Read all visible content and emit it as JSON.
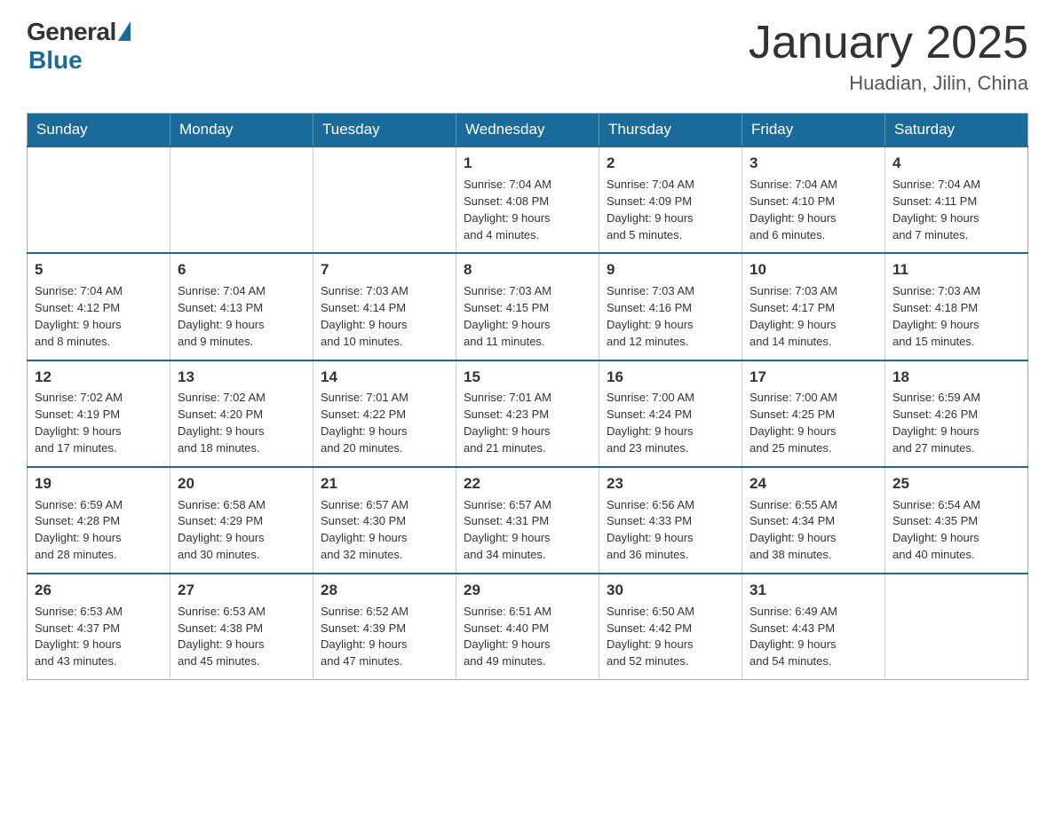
{
  "logo": {
    "general": "General",
    "blue": "Blue"
  },
  "title": "January 2025",
  "subtitle": "Huadian, Jilin, China",
  "headers": [
    "Sunday",
    "Monday",
    "Tuesday",
    "Wednesday",
    "Thursday",
    "Friday",
    "Saturday"
  ],
  "weeks": [
    [
      {
        "day": "",
        "info": ""
      },
      {
        "day": "",
        "info": ""
      },
      {
        "day": "",
        "info": ""
      },
      {
        "day": "1",
        "info": "Sunrise: 7:04 AM\nSunset: 4:08 PM\nDaylight: 9 hours\nand 4 minutes."
      },
      {
        "day": "2",
        "info": "Sunrise: 7:04 AM\nSunset: 4:09 PM\nDaylight: 9 hours\nand 5 minutes."
      },
      {
        "day": "3",
        "info": "Sunrise: 7:04 AM\nSunset: 4:10 PM\nDaylight: 9 hours\nand 6 minutes."
      },
      {
        "day": "4",
        "info": "Sunrise: 7:04 AM\nSunset: 4:11 PM\nDaylight: 9 hours\nand 7 minutes."
      }
    ],
    [
      {
        "day": "5",
        "info": "Sunrise: 7:04 AM\nSunset: 4:12 PM\nDaylight: 9 hours\nand 8 minutes."
      },
      {
        "day": "6",
        "info": "Sunrise: 7:04 AM\nSunset: 4:13 PM\nDaylight: 9 hours\nand 9 minutes."
      },
      {
        "day": "7",
        "info": "Sunrise: 7:03 AM\nSunset: 4:14 PM\nDaylight: 9 hours\nand 10 minutes."
      },
      {
        "day": "8",
        "info": "Sunrise: 7:03 AM\nSunset: 4:15 PM\nDaylight: 9 hours\nand 11 minutes."
      },
      {
        "day": "9",
        "info": "Sunrise: 7:03 AM\nSunset: 4:16 PM\nDaylight: 9 hours\nand 12 minutes."
      },
      {
        "day": "10",
        "info": "Sunrise: 7:03 AM\nSunset: 4:17 PM\nDaylight: 9 hours\nand 14 minutes."
      },
      {
        "day": "11",
        "info": "Sunrise: 7:03 AM\nSunset: 4:18 PM\nDaylight: 9 hours\nand 15 minutes."
      }
    ],
    [
      {
        "day": "12",
        "info": "Sunrise: 7:02 AM\nSunset: 4:19 PM\nDaylight: 9 hours\nand 17 minutes."
      },
      {
        "day": "13",
        "info": "Sunrise: 7:02 AM\nSunset: 4:20 PM\nDaylight: 9 hours\nand 18 minutes."
      },
      {
        "day": "14",
        "info": "Sunrise: 7:01 AM\nSunset: 4:22 PM\nDaylight: 9 hours\nand 20 minutes."
      },
      {
        "day": "15",
        "info": "Sunrise: 7:01 AM\nSunset: 4:23 PM\nDaylight: 9 hours\nand 21 minutes."
      },
      {
        "day": "16",
        "info": "Sunrise: 7:00 AM\nSunset: 4:24 PM\nDaylight: 9 hours\nand 23 minutes."
      },
      {
        "day": "17",
        "info": "Sunrise: 7:00 AM\nSunset: 4:25 PM\nDaylight: 9 hours\nand 25 minutes."
      },
      {
        "day": "18",
        "info": "Sunrise: 6:59 AM\nSunset: 4:26 PM\nDaylight: 9 hours\nand 27 minutes."
      }
    ],
    [
      {
        "day": "19",
        "info": "Sunrise: 6:59 AM\nSunset: 4:28 PM\nDaylight: 9 hours\nand 28 minutes."
      },
      {
        "day": "20",
        "info": "Sunrise: 6:58 AM\nSunset: 4:29 PM\nDaylight: 9 hours\nand 30 minutes."
      },
      {
        "day": "21",
        "info": "Sunrise: 6:57 AM\nSunset: 4:30 PM\nDaylight: 9 hours\nand 32 minutes."
      },
      {
        "day": "22",
        "info": "Sunrise: 6:57 AM\nSunset: 4:31 PM\nDaylight: 9 hours\nand 34 minutes."
      },
      {
        "day": "23",
        "info": "Sunrise: 6:56 AM\nSunset: 4:33 PM\nDaylight: 9 hours\nand 36 minutes."
      },
      {
        "day": "24",
        "info": "Sunrise: 6:55 AM\nSunset: 4:34 PM\nDaylight: 9 hours\nand 38 minutes."
      },
      {
        "day": "25",
        "info": "Sunrise: 6:54 AM\nSunset: 4:35 PM\nDaylight: 9 hours\nand 40 minutes."
      }
    ],
    [
      {
        "day": "26",
        "info": "Sunrise: 6:53 AM\nSunset: 4:37 PM\nDaylight: 9 hours\nand 43 minutes."
      },
      {
        "day": "27",
        "info": "Sunrise: 6:53 AM\nSunset: 4:38 PM\nDaylight: 9 hours\nand 45 minutes."
      },
      {
        "day": "28",
        "info": "Sunrise: 6:52 AM\nSunset: 4:39 PM\nDaylight: 9 hours\nand 47 minutes."
      },
      {
        "day": "29",
        "info": "Sunrise: 6:51 AM\nSunset: 4:40 PM\nDaylight: 9 hours\nand 49 minutes."
      },
      {
        "day": "30",
        "info": "Sunrise: 6:50 AM\nSunset: 4:42 PM\nDaylight: 9 hours\nand 52 minutes."
      },
      {
        "day": "31",
        "info": "Sunrise: 6:49 AM\nSunset: 4:43 PM\nDaylight: 9 hours\nand 54 minutes."
      },
      {
        "day": "",
        "info": ""
      }
    ]
  ]
}
